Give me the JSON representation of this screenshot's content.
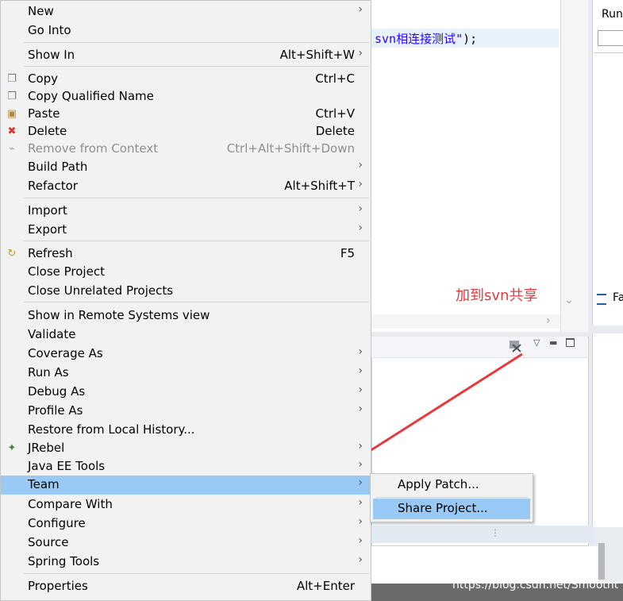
{
  "editor": {
    "code_text": "svn相连接测试\"",
    "code_end": ");"
  },
  "right_panel": {
    "run_label": "Run",
    "fa_label": "Fa"
  },
  "annotation": "加到svn共享",
  "watermark": "https://blog.csdn.net/Smootht",
  "context_menu": {
    "items": [
      {
        "label": "New",
        "shortcut": "",
        "submenu": true
      },
      {
        "label": "Go Into",
        "shortcut": "",
        "submenu": false
      },
      {
        "label": "Show In",
        "shortcut": "Alt+Shift+W",
        "submenu": true
      },
      {
        "label": "Copy",
        "shortcut": "Ctrl+C",
        "submenu": false,
        "icon": "copy-icon"
      },
      {
        "label": "Copy Qualified Name",
        "shortcut": "",
        "submenu": false,
        "icon": "copy-qualified-icon"
      },
      {
        "label": "Paste",
        "shortcut": "Ctrl+V",
        "submenu": false,
        "icon": "paste-icon"
      },
      {
        "label": "Delete",
        "shortcut": "Delete",
        "submenu": false,
        "icon": "delete-icon"
      },
      {
        "label": "Remove from Context",
        "shortcut": "Ctrl+Alt+Shift+Down",
        "submenu": false,
        "disabled": true,
        "icon": "remove-context-icon"
      },
      {
        "label": "Build Path",
        "shortcut": "",
        "submenu": true
      },
      {
        "label": "Refactor",
        "shortcut": "Alt+Shift+T",
        "submenu": true
      },
      {
        "label": "Import",
        "shortcut": "",
        "submenu": true
      },
      {
        "label": "Export",
        "shortcut": "",
        "submenu": true
      },
      {
        "label": "Refresh",
        "shortcut": "F5",
        "submenu": false,
        "icon": "refresh-icon"
      },
      {
        "label": "Close Project",
        "shortcut": "",
        "submenu": false
      },
      {
        "label": "Close Unrelated Projects",
        "shortcut": "",
        "submenu": false
      },
      {
        "label": "Show in Remote Systems view",
        "shortcut": "",
        "submenu": false
      },
      {
        "label": "Validate",
        "shortcut": "",
        "submenu": false
      },
      {
        "label": "Coverage As",
        "shortcut": "",
        "submenu": true
      },
      {
        "label": "Run As",
        "shortcut": "",
        "submenu": true
      },
      {
        "label": "Debug As",
        "shortcut": "",
        "submenu": true
      },
      {
        "label": "Profile As",
        "shortcut": "",
        "submenu": true
      },
      {
        "label": "Restore from Local History...",
        "shortcut": "",
        "submenu": false
      },
      {
        "label": "JRebel",
        "shortcut": "",
        "submenu": true,
        "icon": "jrebel-icon"
      },
      {
        "label": "Java EE Tools",
        "shortcut": "",
        "submenu": true
      },
      {
        "label": "Team",
        "shortcut": "",
        "submenu": true,
        "highlighted": true
      },
      {
        "label": "Compare With",
        "shortcut": "",
        "submenu": true
      },
      {
        "label": "Configure",
        "shortcut": "",
        "submenu": true
      },
      {
        "label": "Source",
        "shortcut": "",
        "submenu": true
      },
      {
        "label": "Spring Tools",
        "shortcut": "",
        "submenu": true
      },
      {
        "label": "Properties",
        "shortcut": "Alt+Enter",
        "submenu": false
      }
    ]
  },
  "team_submenu": {
    "items": [
      {
        "label": "Apply Patch..."
      },
      {
        "label": "Share Project...",
        "highlighted": true
      }
    ]
  },
  "colors": {
    "highlight": "#99c9f5",
    "annotation": "#e8383d",
    "menu_bg": "#f2f2f2"
  }
}
